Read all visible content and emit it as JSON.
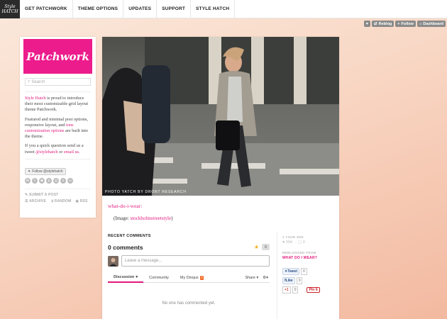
{
  "brand": {
    "line1": "Style",
    "line2": "HATCH"
  },
  "nav": [
    "GET PATCHWORK",
    "THEME OPTIONS",
    "UPDATES",
    "SUPPORT",
    "STYLE HATCH"
  ],
  "tumblr_controls": {
    "reblog": "Reblog",
    "follow": "Follow",
    "dashboard": "Dashboard"
  },
  "sidebar": {
    "logo": "Patchwork",
    "search_placeholder": "Search",
    "p1_link": "Style Hatch",
    "p1_text": " is proud to introduce their most customizable grid layout theme Patchwork.",
    "p2_text_a": "Featured and minimal post options, responsive layout, and ",
    "p2_link": "tons customization options",
    "p2_text_b": " are built into the theme.",
    "p3_text_a": "If you a quick question send us a tweet ",
    "p3_link1": "@stylehatch",
    "p3_text_b": " or ",
    "p3_link2": "email us",
    "p3_text_c": ".",
    "follow_label": "Follow @stylehatch",
    "submit": "SUBMIT A POST",
    "archive": "ARCHIVE",
    "random": "RANDOM",
    "rss": "RSS"
  },
  "post": {
    "photo_credit": "PHOTO YATCH BY DRONT RESEARCH",
    "title": "what-do-i-wear:",
    "body_prefix": "(Image: ",
    "body_link": "stockholmstreetstyle",
    "body_suffix": ")"
  },
  "comments": {
    "heading": "RECENT COMMENTS",
    "count": "0 comments",
    "vote_count": "0",
    "placeholder": "Leave a message...",
    "tab_discussion": "Discussion",
    "tab_community": "Community",
    "tab_disqus": "My Disqus",
    "disqus_badge": "2",
    "share": "Share",
    "empty": "No one has commented yet."
  },
  "side_meta": {
    "notes_label": "1 YOUR SEE",
    "likes": "394",
    "notes": "0",
    "reblogged_label": "REBLOGGED FROM",
    "reblogged_from": "WHAT DO I WEAR?",
    "tweet": "Tweet",
    "tweet_count": "0",
    "like": "Like",
    "like_count": "0",
    "gplus": "+1",
    "gplus_count": "0",
    "pin": "Pin it"
  }
}
